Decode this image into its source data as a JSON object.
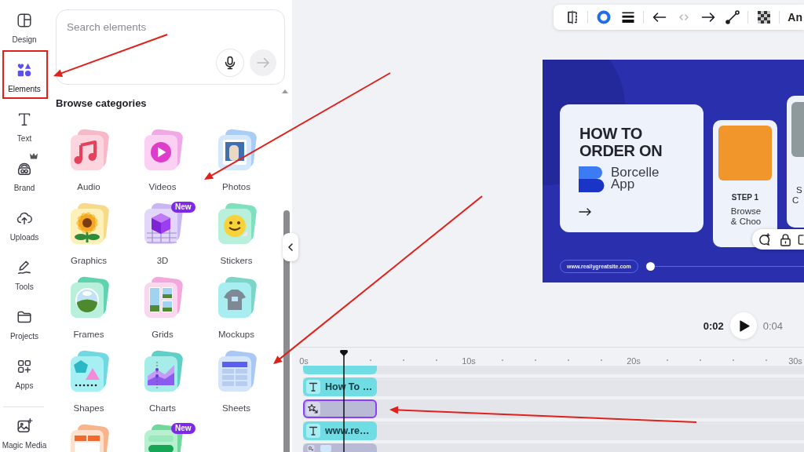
{
  "sidebar": {
    "items": [
      {
        "label": "Design",
        "selected": false,
        "premium": false
      },
      {
        "label": "Elements",
        "selected": true,
        "premium": false
      },
      {
        "label": "Text",
        "selected": false,
        "premium": false
      },
      {
        "label": "Brand",
        "selected": false,
        "premium": true
      },
      {
        "label": "Uploads",
        "selected": false,
        "premium": false
      },
      {
        "label": "Tools",
        "selected": false,
        "premium": false
      },
      {
        "label": "Projects",
        "selected": false,
        "premium": false
      },
      {
        "label": "Apps",
        "selected": false,
        "premium": false
      }
    ],
    "bottom_items": [
      {
        "label": "Magic Media",
        "selected": false,
        "premium": false
      }
    ]
  },
  "panel": {
    "search": {
      "placeholder": "Search elements",
      "submit_disabled": true
    },
    "heading": "Browse categories",
    "categories": [
      {
        "label": "Audio",
        "partial": false
      },
      {
        "label": "Videos",
        "partial": false
      },
      {
        "label": "Photos",
        "partial": false
      },
      {
        "label": "Graphics",
        "partial": false
      },
      {
        "label": "3D",
        "partial": false,
        "badge": "New"
      },
      {
        "label": "Stickers",
        "partial": false
      },
      {
        "label": "Frames",
        "partial": false
      },
      {
        "label": "Grids",
        "partial": false
      },
      {
        "label": "Mockups",
        "partial": false
      },
      {
        "label": "Shapes",
        "partial": false
      },
      {
        "label": "Charts",
        "partial": false
      },
      {
        "label": "Sheets",
        "partial": false
      },
      {
        "partial": true
      },
      {
        "partial": true,
        "badge": "New"
      }
    ]
  },
  "toolbar": {
    "tools": [
      {
        "disabled": false
      },
      {
        "disabled": false
      },
      {
        "disabled": false
      },
      {
        "disabled": false
      },
      {
        "disabled": true
      },
      {
        "disabled": false
      },
      {
        "disabled": false
      },
      {
        "disabled": false
      }
    ],
    "button_label": "An"
  },
  "slide": {
    "title": "HOW TO ORDER ON",
    "brand": "Borcelle App",
    "steps": [
      {
        "label": "STEP 1",
        "text": "Browse & Choo"
      },
      {
        "label": "S",
        "text": "C"
      }
    ],
    "url": "www.reallygreatsite.com"
  },
  "playback": {
    "current": "0:02",
    "total": "0:04"
  },
  "timeline": {
    "ruler": [
      "0s",
      "10s",
      "20s",
      "30s"
    ],
    "clips": [
      {
        "kind": "text",
        "selected": false,
        "partial": true
      },
      {
        "kind": "text",
        "label": "How To …",
        "selected": false,
        "partial": false
      },
      {
        "kind": "graphic",
        "selected": true,
        "partial": false
      },
      {
        "kind": "text",
        "label": "www.re…",
        "selected": false,
        "partial": false
      },
      {
        "kind": "graphic",
        "selected": false,
        "partial": true
      }
    ]
  }
}
